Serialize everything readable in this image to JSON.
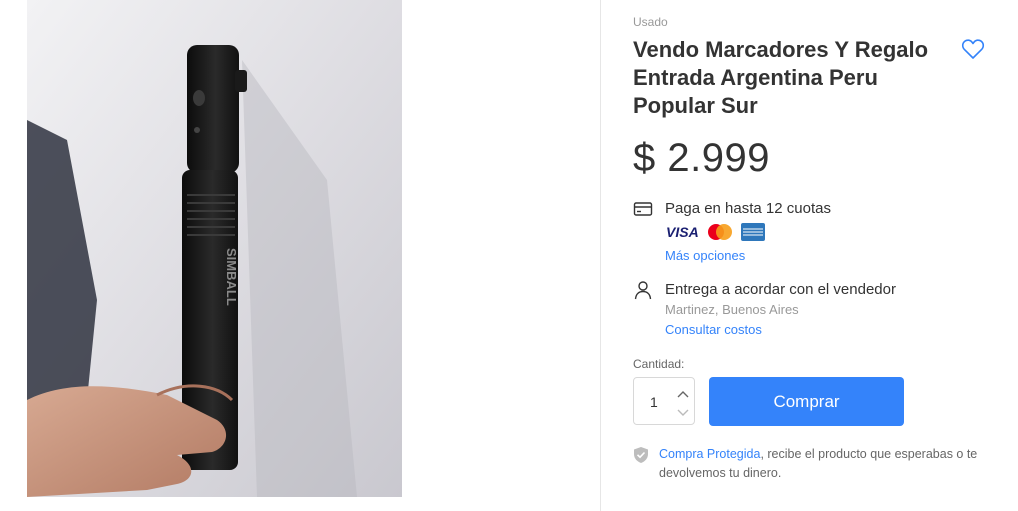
{
  "listing": {
    "condition": "Usado",
    "title": "Vendo Marcadores Y Regalo Entrada Argentina Peru Popular Sur",
    "price": "$ 2.999"
  },
  "photo": {
    "marker_brand": "SIMBALL",
    "colors": {
      "wall": "#dedde2",
      "marker": "#1c1c1c",
      "hand": "#c99680",
      "shadow": "#2f3340"
    }
  },
  "payment": {
    "label": "Paga en hasta 12 cuotas",
    "cards": [
      "visa-card-icon",
      "mastercard-icon",
      "amex-card-icon"
    ],
    "more_options": "Más opciones"
  },
  "shipping": {
    "label": "Entrega a acordar con el vendedor",
    "location": "Martinez, Buenos Aires",
    "costs_link": "Consultar costos"
  },
  "quantity": {
    "label": "Cantidad:",
    "value": "1"
  },
  "buy": {
    "label": "Comprar"
  },
  "protection": {
    "link": "Compra Protegida",
    "text": ", recibe el producto que esperabas o te devolvemos tu dinero."
  },
  "theme": {
    "accent": "#3483fa",
    "text": "#333333",
    "muted": "#999999"
  }
}
